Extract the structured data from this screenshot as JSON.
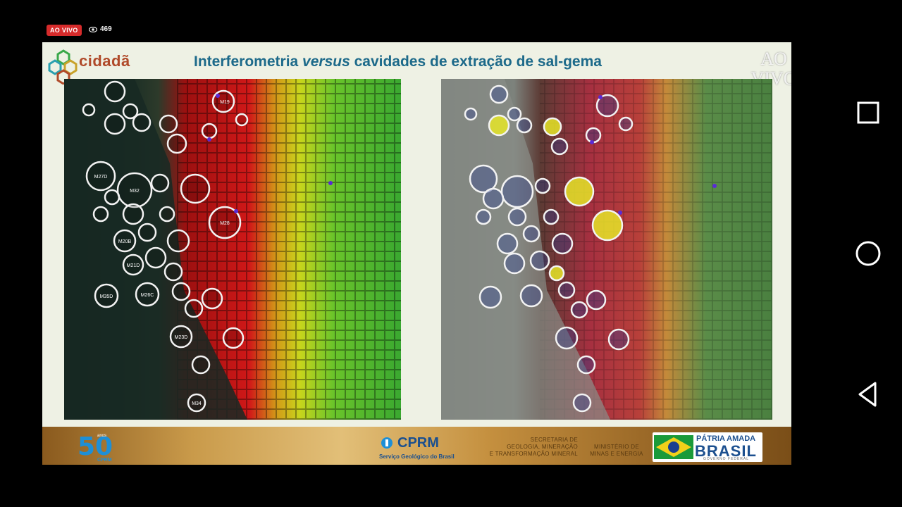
{
  "stream": {
    "live_label": "AO VIVO",
    "viewer_count": "469",
    "watermark": [
      "AO",
      "VIVO"
    ]
  },
  "slide": {
    "logo_text": "cidadã",
    "title_pre": "Interferometria ",
    "title_em": "versus",
    "title_post": " cavidades de extração de sal-gema"
  },
  "footer": {
    "anniversary": {
      "number": "50",
      "anos": "anos",
      "cprm": "CPRM"
    },
    "cprm": {
      "name": "CPRM",
      "subtitle": "Serviço Geológico do Brasil"
    },
    "secretaria": [
      "SECRETARIA DE",
      "GEOLOGIA, MINERAÇÃO",
      "E TRANSFORMAÇÃO MINERAL"
    ],
    "ministerio": [
      "MINISTÉRIO DE",
      "MINAS E ENERGIA"
    ],
    "patria": "PÁTRIA AMADA",
    "brasil": "BRASIL",
    "governo": "GOVERNO FEDERAL"
  },
  "left_map_labels": [
    "M27D",
    "M32",
    "M35D",
    "M20B",
    "M26C",
    "M21D",
    "M23D",
    "M19",
    "M28",
    "M34"
  ],
  "icons": [
    "eye-icon",
    "overview-square-icon",
    "home-circle-icon",
    "back-triangle-icon"
  ]
}
